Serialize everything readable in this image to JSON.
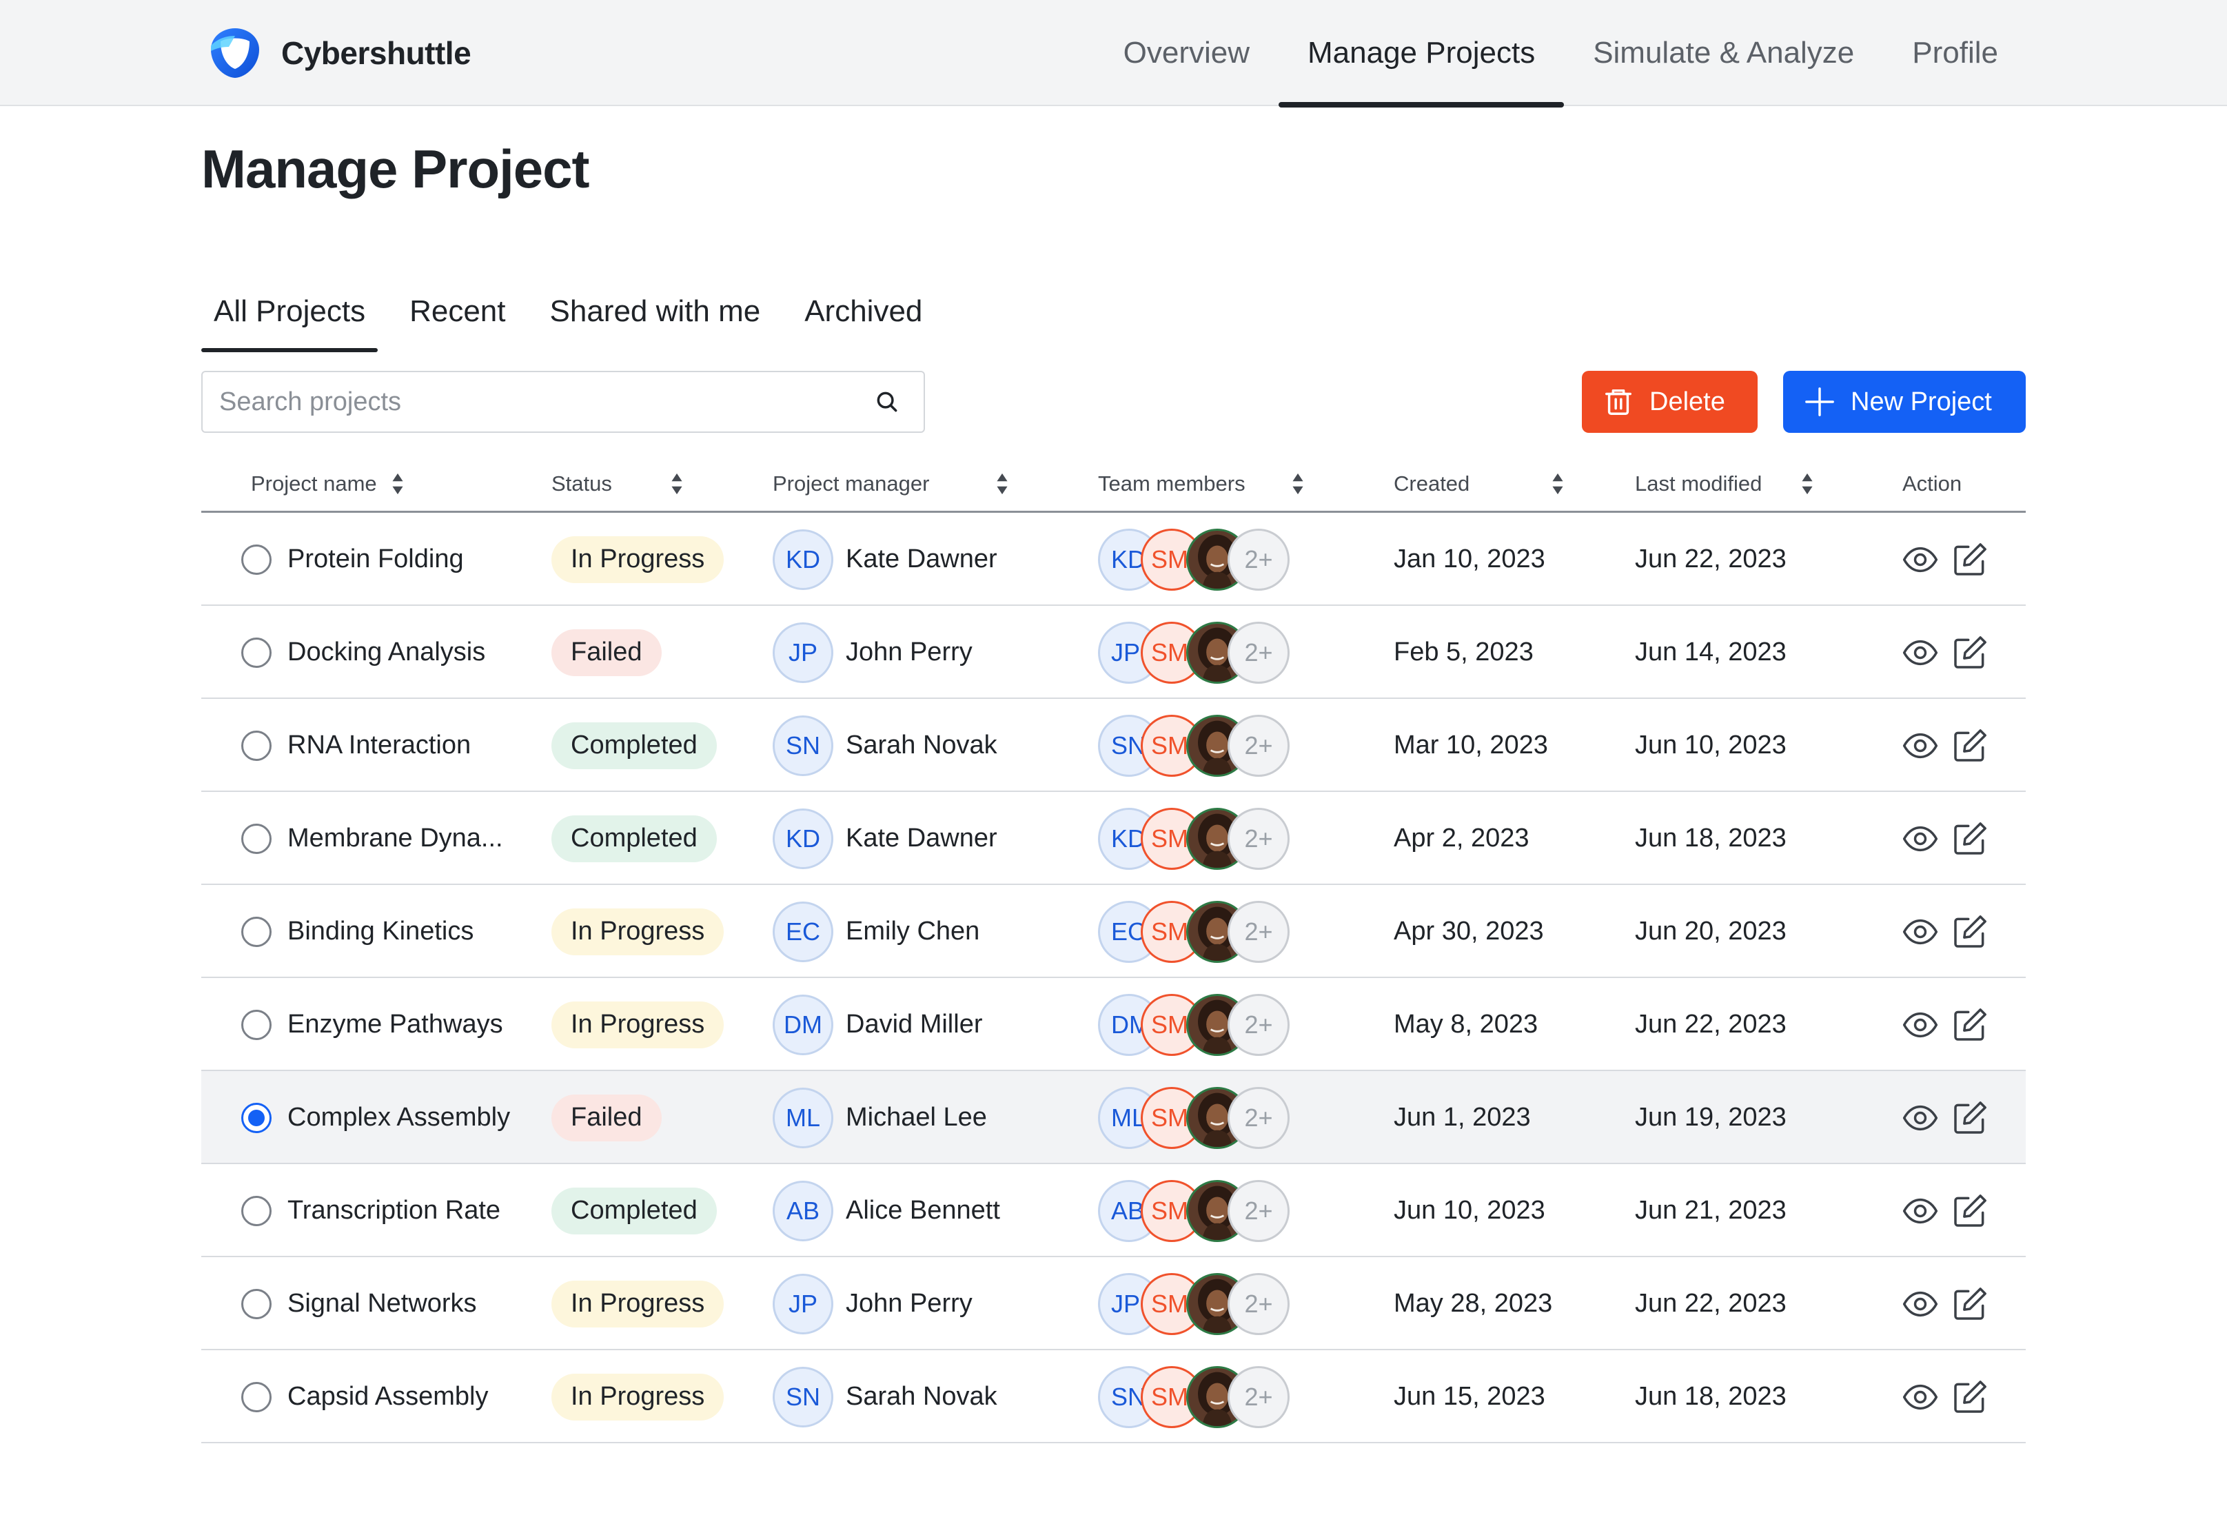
{
  "brand": {
    "name": "Cybershuttle"
  },
  "nav": [
    {
      "label": "Overview",
      "active": false
    },
    {
      "label": "Manage Projects",
      "active": true
    },
    {
      "label": "Simulate & Analyze",
      "active": false
    },
    {
      "label": "Profile",
      "active": false
    }
  ],
  "page_title": "Manage Project",
  "tabs": [
    {
      "label": "All Projects",
      "active": true
    },
    {
      "label": "Recent",
      "active": false
    },
    {
      "label": "Shared with me",
      "active": false
    },
    {
      "label": "Archived",
      "active": false
    }
  ],
  "search": {
    "placeholder": "Search projects",
    "value": ""
  },
  "buttons": {
    "delete": "Delete",
    "new_project": "New Project"
  },
  "colors": {
    "accent": "#1461f5",
    "danger": "#f04a22",
    "in_progress_bg": "#fdf6dc",
    "failed_bg": "#fbe6e3",
    "completed_bg": "#e2f3ea"
  },
  "table": {
    "columns": [
      "Project name",
      "Status",
      "Project manager",
      "Team members",
      "Created",
      "Last modified",
      "Action"
    ],
    "rows": [
      {
        "name": "Protein Folding",
        "status": "In Progress",
        "manager_initials": "KD",
        "manager": "Kate Dawner",
        "team": [
          "KD",
          "SM",
          "photo",
          "2+"
        ],
        "created": "Jan 10, 2023",
        "modified": "Jun 22, 2023",
        "selected": false
      },
      {
        "name": "Docking Analysis",
        "status": "Failed",
        "manager_initials": "JP",
        "manager": "John Perry",
        "team": [
          "JP",
          "SM",
          "photo",
          "2+"
        ],
        "created": "Feb 5, 2023",
        "modified": "Jun 14, 2023",
        "selected": false
      },
      {
        "name": "RNA Interaction",
        "status": "Completed",
        "manager_initials": "SN",
        "manager": "Sarah Novak",
        "team": [
          "SN",
          "SM",
          "photo",
          "2+"
        ],
        "created": "Mar 10, 2023",
        "modified": "Jun 10, 2023",
        "selected": false
      },
      {
        "name": "Membrane Dyna...",
        "status": "Completed",
        "manager_initials": "KD",
        "manager": "Kate Dawner",
        "team": [
          "KD",
          "SM",
          "photo",
          "2+"
        ],
        "created": "Apr 2, 2023",
        "modified": "Jun 18, 2023",
        "selected": false
      },
      {
        "name": "Binding Kinetics",
        "status": "In Progress",
        "manager_initials": "EC",
        "manager": "Emily Chen",
        "team": [
          "EC",
          "SM",
          "photo",
          "2+"
        ],
        "created": "Apr 30, 2023",
        "modified": "Jun 20, 2023",
        "selected": false
      },
      {
        "name": "Enzyme Pathways",
        "status": "In Progress",
        "manager_initials": "DM",
        "manager": "David Miller",
        "team": [
          "DM",
          "SM",
          "photo",
          "2+"
        ],
        "created": "May 8, 2023",
        "modified": "Jun 22, 2023",
        "selected": false
      },
      {
        "name": "Complex Assembly",
        "status": "Failed",
        "manager_initials": "ML",
        "manager": "Michael Lee",
        "team": [
          "ML",
          "SM",
          "photo",
          "2+"
        ],
        "created": "Jun 1, 2023",
        "modified": "Jun 19, 2023",
        "selected": true
      },
      {
        "name": "Transcription Rate",
        "status": "Completed",
        "manager_initials": "AB",
        "manager": "Alice Bennett",
        "team": [
          "AB",
          "SM",
          "photo",
          "2+"
        ],
        "created": "Jun 10, 2023",
        "modified": "Jun 21, 2023",
        "selected": false
      },
      {
        "name": "Signal Networks",
        "status": "In Progress",
        "manager_initials": "JP",
        "manager": "John Perry",
        "team": [
          "JP",
          "SM",
          "photo",
          "2+"
        ],
        "created": "May 28, 2023",
        "modified": "Jun 22, 2023",
        "selected": false
      },
      {
        "name": "Capsid Assembly",
        "status": "In Progress",
        "manager_initials": "SN",
        "manager": "Sarah Novak",
        "team": [
          "SN",
          "SM",
          "photo",
          "2+"
        ],
        "created": "Jun 15, 2023",
        "modified": "Jun 18, 2023",
        "selected": false
      }
    ]
  }
}
